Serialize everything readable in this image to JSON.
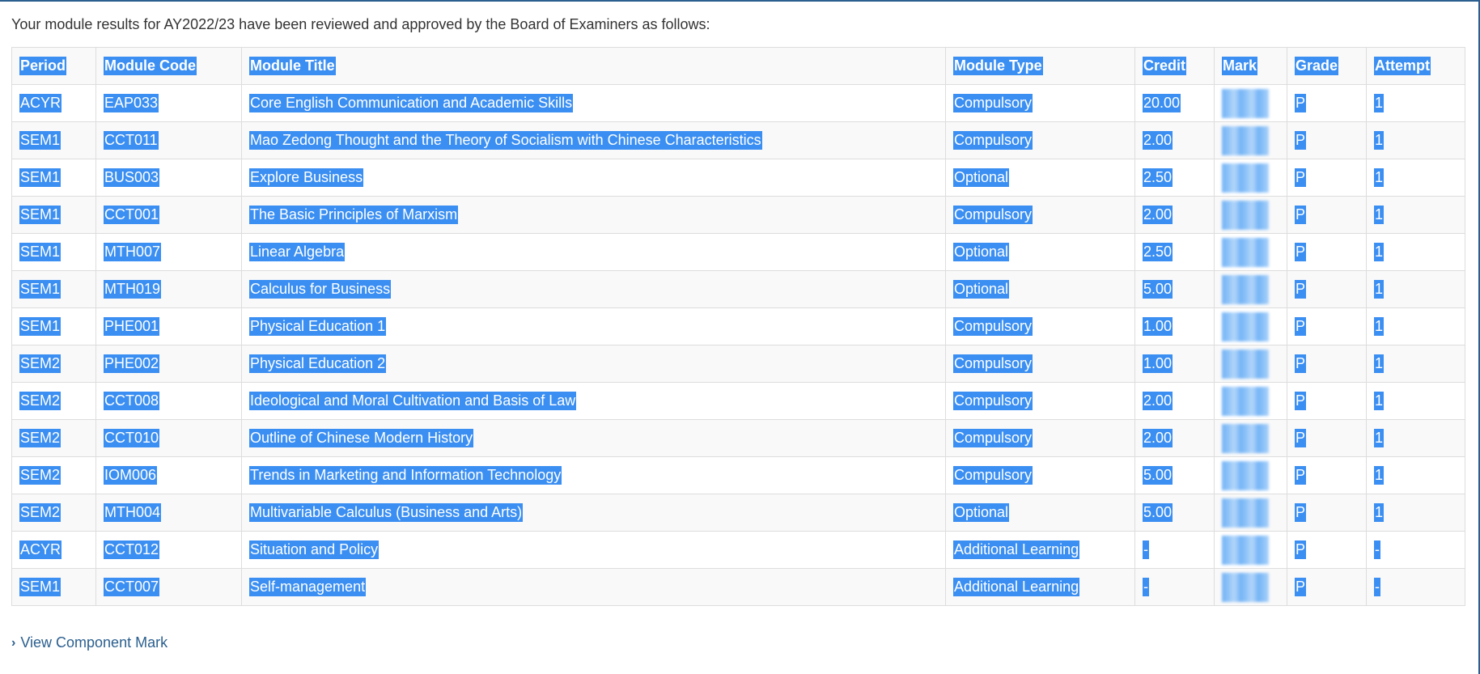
{
  "intro_text": "Your module results for AY2022/23 have been reviewed and approved by the Board of Examiners as follows:",
  "table": {
    "headers": [
      "Period",
      "Module Code",
      "Module Title",
      "Module Type",
      "Credit",
      "Mark",
      "Grade",
      "Attempt"
    ],
    "rows": [
      {
        "period": "ACYR",
        "code": "EAP033",
        "title": "Core English Communication and Academic Skills",
        "type": "Compulsory",
        "credit": "20.00",
        "grade": "P",
        "attempt": "1"
      },
      {
        "period": "SEM1",
        "code": "CCT011",
        "title": "Mao Zedong Thought and the Theory of Socialism with Chinese Characteristics",
        "type": "Compulsory",
        "credit": "2.00",
        "grade": "P",
        "attempt": "1"
      },
      {
        "period": "SEM1",
        "code": "BUS003",
        "title": "Explore Business",
        "type": "Optional",
        "credit": "2.50",
        "grade": "P",
        "attempt": "1"
      },
      {
        "period": "SEM1",
        "code": "CCT001",
        "title": "The Basic Principles of Marxism",
        "type": "Compulsory",
        "credit": "2.00",
        "grade": "P",
        "attempt": "1"
      },
      {
        "period": "SEM1",
        "code": "MTH007",
        "title": "Linear Algebra",
        "type": "Optional",
        "credit": "2.50",
        "grade": "P",
        "attempt": "1"
      },
      {
        "period": "SEM1",
        "code": "MTH019",
        "title": "Calculus for Business",
        "type": "Optional",
        "credit": "5.00",
        "grade": "P",
        "attempt": "1"
      },
      {
        "period": "SEM1",
        "code": "PHE001",
        "title": "Physical Education 1",
        "type": "Compulsory",
        "credit": "1.00",
        "grade": "P",
        "attempt": "1"
      },
      {
        "period": "SEM2",
        "code": "PHE002",
        "title": "Physical Education 2",
        "type": "Compulsory",
        "credit": "1.00",
        "grade": "P",
        "attempt": "1"
      },
      {
        "period": "SEM2",
        "code": "CCT008",
        "title": "Ideological and Moral Cultivation and Basis of Law",
        "type": "Compulsory",
        "credit": "2.00",
        "grade": "P",
        "attempt": "1"
      },
      {
        "period": "SEM2",
        "code": "CCT010",
        "title": "Outline of Chinese Modern History",
        "type": "Compulsory",
        "credit": "2.00",
        "grade": "P",
        "attempt": "1"
      },
      {
        "period": "SEM2",
        "code": "IOM006",
        "title": "Trends in Marketing and Information Technology",
        "type": "Compulsory",
        "credit": "5.00",
        "grade": "P",
        "attempt": "1"
      },
      {
        "period": "SEM2",
        "code": "MTH004",
        "title": "Multivariable Calculus (Business and Arts)",
        "type": "Optional",
        "credit": "5.00",
        "grade": "P",
        "attempt": "1"
      },
      {
        "period": "ACYR",
        "code": "CCT012",
        "title": "Situation and Policy",
        "type": "Additional Learning",
        "credit": "-",
        "grade": "P",
        "attempt": "-"
      },
      {
        "period": "SEM1",
        "code": "CCT007",
        "title": "Self-management",
        "type": "Additional Learning",
        "credit": "-",
        "grade": "P",
        "attempt": "-"
      }
    ]
  },
  "link": {
    "label": "View Component Mark",
    "icon": "chevron-right-icon"
  },
  "colors": {
    "selection": "#3b8ff2",
    "link": "#2b5f8f",
    "border": "#dddddd",
    "stripe": "#f9f9f9"
  }
}
